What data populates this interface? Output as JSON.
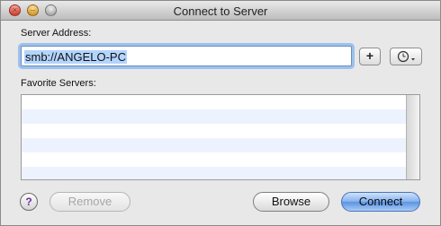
{
  "window": {
    "title": "Connect to Server"
  },
  "form": {
    "server_address_label": "Server Address:",
    "server_address_value": "smb://ANGELO-PC",
    "add_button_label": "+",
    "favorite_servers_label": "Favorite Servers:",
    "favorite_servers": []
  },
  "buttons": {
    "help_label": "?",
    "remove_label": "Remove",
    "browse_label": "Browse",
    "connect_label": "Connect"
  },
  "icons": {
    "recent_servers": "clock-icon",
    "dropdown": "chevron-down-icon"
  },
  "colors": {
    "selection_highlight": "#b3d4fc",
    "focus_ring": "#9cc1ee",
    "default_button": "#5b93e4",
    "list_alt_row": "#edf3fe"
  }
}
